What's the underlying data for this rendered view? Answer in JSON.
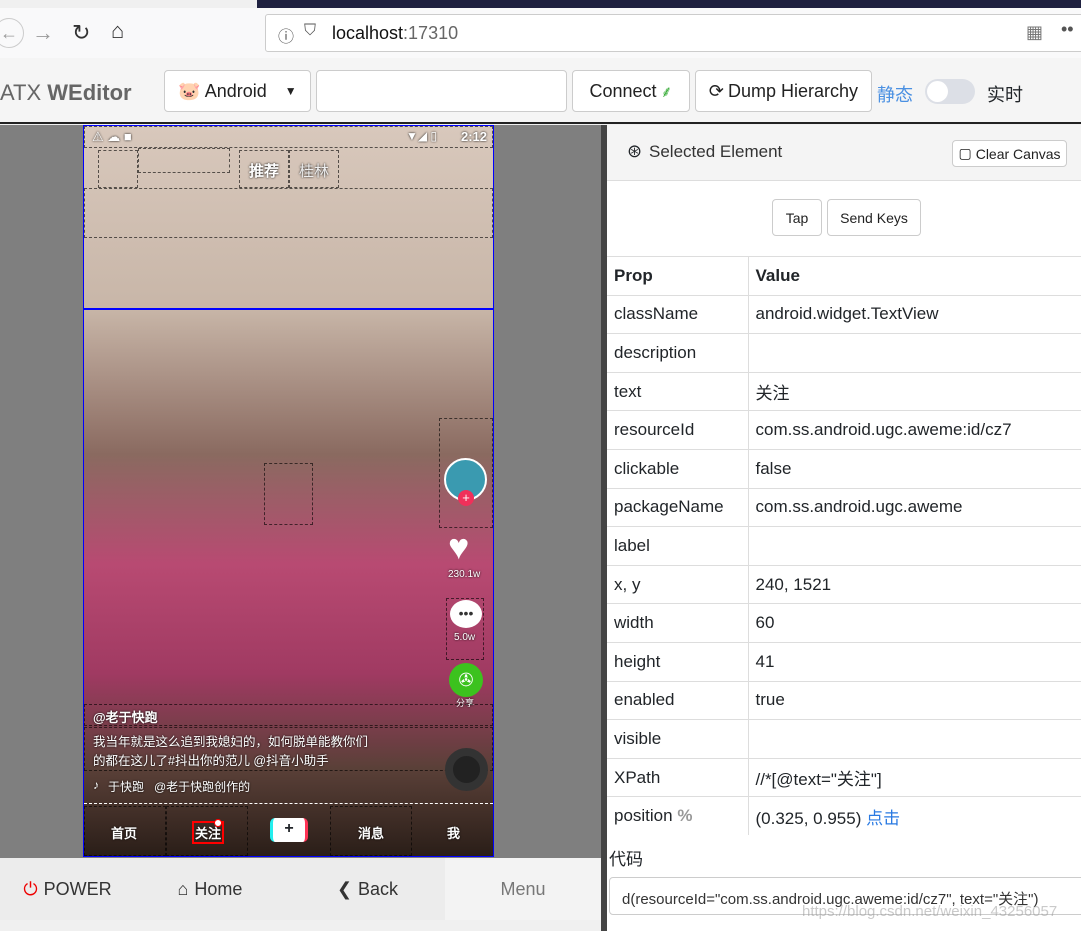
{
  "browser": {
    "url_host": "localhost",
    "url_port": ":17310"
  },
  "toolbar": {
    "brand_prefix": "ATX ",
    "brand_name": "WEditor",
    "platform": "Android",
    "device_input": "",
    "connect": "Connect",
    "dump": "Dump Hierarchy",
    "mode_static": "静态",
    "mode_realtime": "实时",
    "realtime_on": false
  },
  "phone": {
    "status_time": "2:12",
    "tab_recommend": "推荐",
    "tab_city": "桂林",
    "likes": "230.1w",
    "comments": "5.0w",
    "share": "分享",
    "author": "@老于快跑",
    "caption_line1": "我当年就是这么追到我媳妇的，如何脱单能教你们",
    "caption_line2": "的都在这儿了#抖出你的范儿 @抖音小助手",
    "music": "于快跑   @老于快跑创作的",
    "nav": [
      "首页",
      "关注",
      "+",
      "消息",
      "我"
    ]
  },
  "bottom": {
    "power": "POWER",
    "home": "Home",
    "back": "Back",
    "menu": "Menu"
  },
  "panel": {
    "title": "Selected Element",
    "clear": "Clear Canvas",
    "tap": "Tap",
    "send_keys": "Send Keys",
    "headers": [
      "Prop",
      "Value"
    ],
    "rows": [
      [
        "className",
        "android.widget.TextView"
      ],
      [
        "description",
        ""
      ],
      [
        "text",
        "关注"
      ],
      [
        "resourceId",
        "com.ss.android.ugc.aweme:id/cz7"
      ],
      [
        "clickable",
        "false"
      ],
      [
        "packageName",
        "com.ss.android.ugc.aweme"
      ],
      [
        "label",
        ""
      ],
      [
        "x, y",
        "240, 1521"
      ],
      [
        "width",
        "60"
      ],
      [
        "height",
        "41"
      ],
      [
        "enabled",
        "true"
      ],
      [
        "visible",
        ""
      ],
      [
        "XPath",
        "//*[@text=\"关注\"]"
      ]
    ],
    "position_label": "position",
    "position_icon": "%",
    "position_value": "(0.325, 0.955)",
    "position_click": "点击",
    "code_label": "代码",
    "code": "d(resourceId=\"com.ss.android.ugc.aweme:id/cz7\", text=\"关注\")"
  },
  "watermark": "https://blog.csdn.net/weixin_43256057",
  "colors": {
    "link": "#2a7ae2",
    "selected_outline": "#ff0000",
    "hierarchy_line": "#0000ff"
  }
}
